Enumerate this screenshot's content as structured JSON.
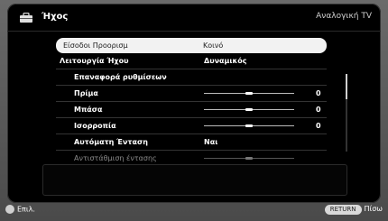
{
  "header": {
    "icon": "toolbox-icon",
    "title": "Ήχος",
    "source": "Αναλογική TV"
  },
  "menu": {
    "items": [
      {
        "label": "Είσοδοι Προορισμ",
        "value": "Κοινό"
      },
      {
        "label": "Λειτουργία Ήχου",
        "value": "Δυναμικός"
      },
      {
        "label": "Επαναφορά ρυθμίσεων"
      },
      {
        "label": "Πρίμα",
        "value": "0",
        "level_percent": 50
      },
      {
        "label": "Μπάσα",
        "value": "0",
        "level_percent": 50
      },
      {
        "label": "Ισορροπία",
        "value": "0",
        "level_percent": 50
      },
      {
        "label": "Αυτόματη Ένταση",
        "value": "Ναι"
      },
      {
        "label": "Αντιστάθμιση έντασης",
        "level_percent": 50
      }
    ]
  },
  "footer": {
    "select_label": "Επιλ.",
    "return_key": "RETURN",
    "back_label": "Πίσω"
  },
  "colors": {
    "panel_bg": "#000000",
    "frame_bg": "#5a5a5a",
    "highlight": "#f2f2f2"
  }
}
